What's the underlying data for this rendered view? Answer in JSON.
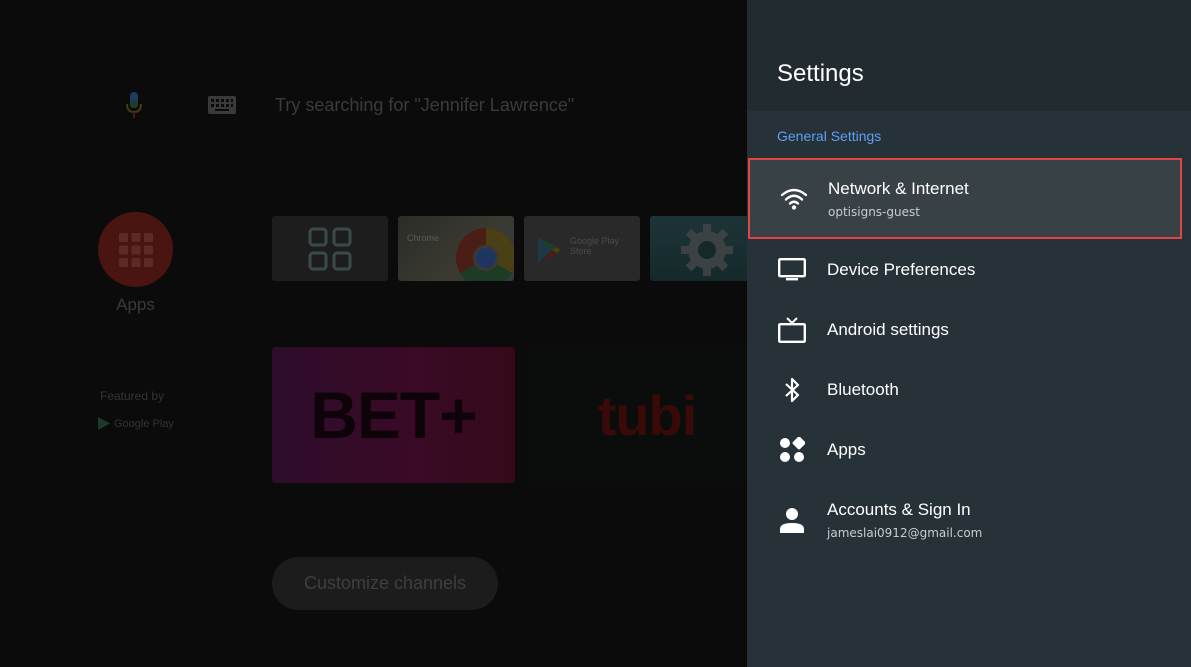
{
  "home": {
    "search_hint": "Try searching for \"Jennifer Lawrence\"",
    "apps_label": "Apps",
    "featured_by": "Featured by",
    "google_play": "Google Play",
    "tiles": {
      "chrome": "Chrome",
      "play_store": "Google Play Store"
    },
    "bet_tile": "BET+",
    "tubi_tile": "tubi",
    "customize_channels": "Customize channels"
  },
  "settings": {
    "title": "Settings",
    "section": "General Settings",
    "items": [
      {
        "label": "Network & Internet",
        "sub": "optisigns-guest",
        "icon": "wifi-icon",
        "selected": true
      },
      {
        "label": "Device Preferences",
        "icon": "tv-monitor-icon"
      },
      {
        "label": "Android settings",
        "icon": "tv-antenna-icon"
      },
      {
        "label": "Bluetooth",
        "icon": "bluetooth-icon"
      },
      {
        "label": "Apps",
        "icon": "apps-dots-icon"
      },
      {
        "label": "Accounts & Sign In",
        "sub": "jameslai0912@gmail.com",
        "icon": "person-icon"
      }
    ]
  },
  "colors": {
    "panel_bg": "#263238",
    "accent_blue": "#5e9ff5",
    "selection_border": "#e24545"
  }
}
